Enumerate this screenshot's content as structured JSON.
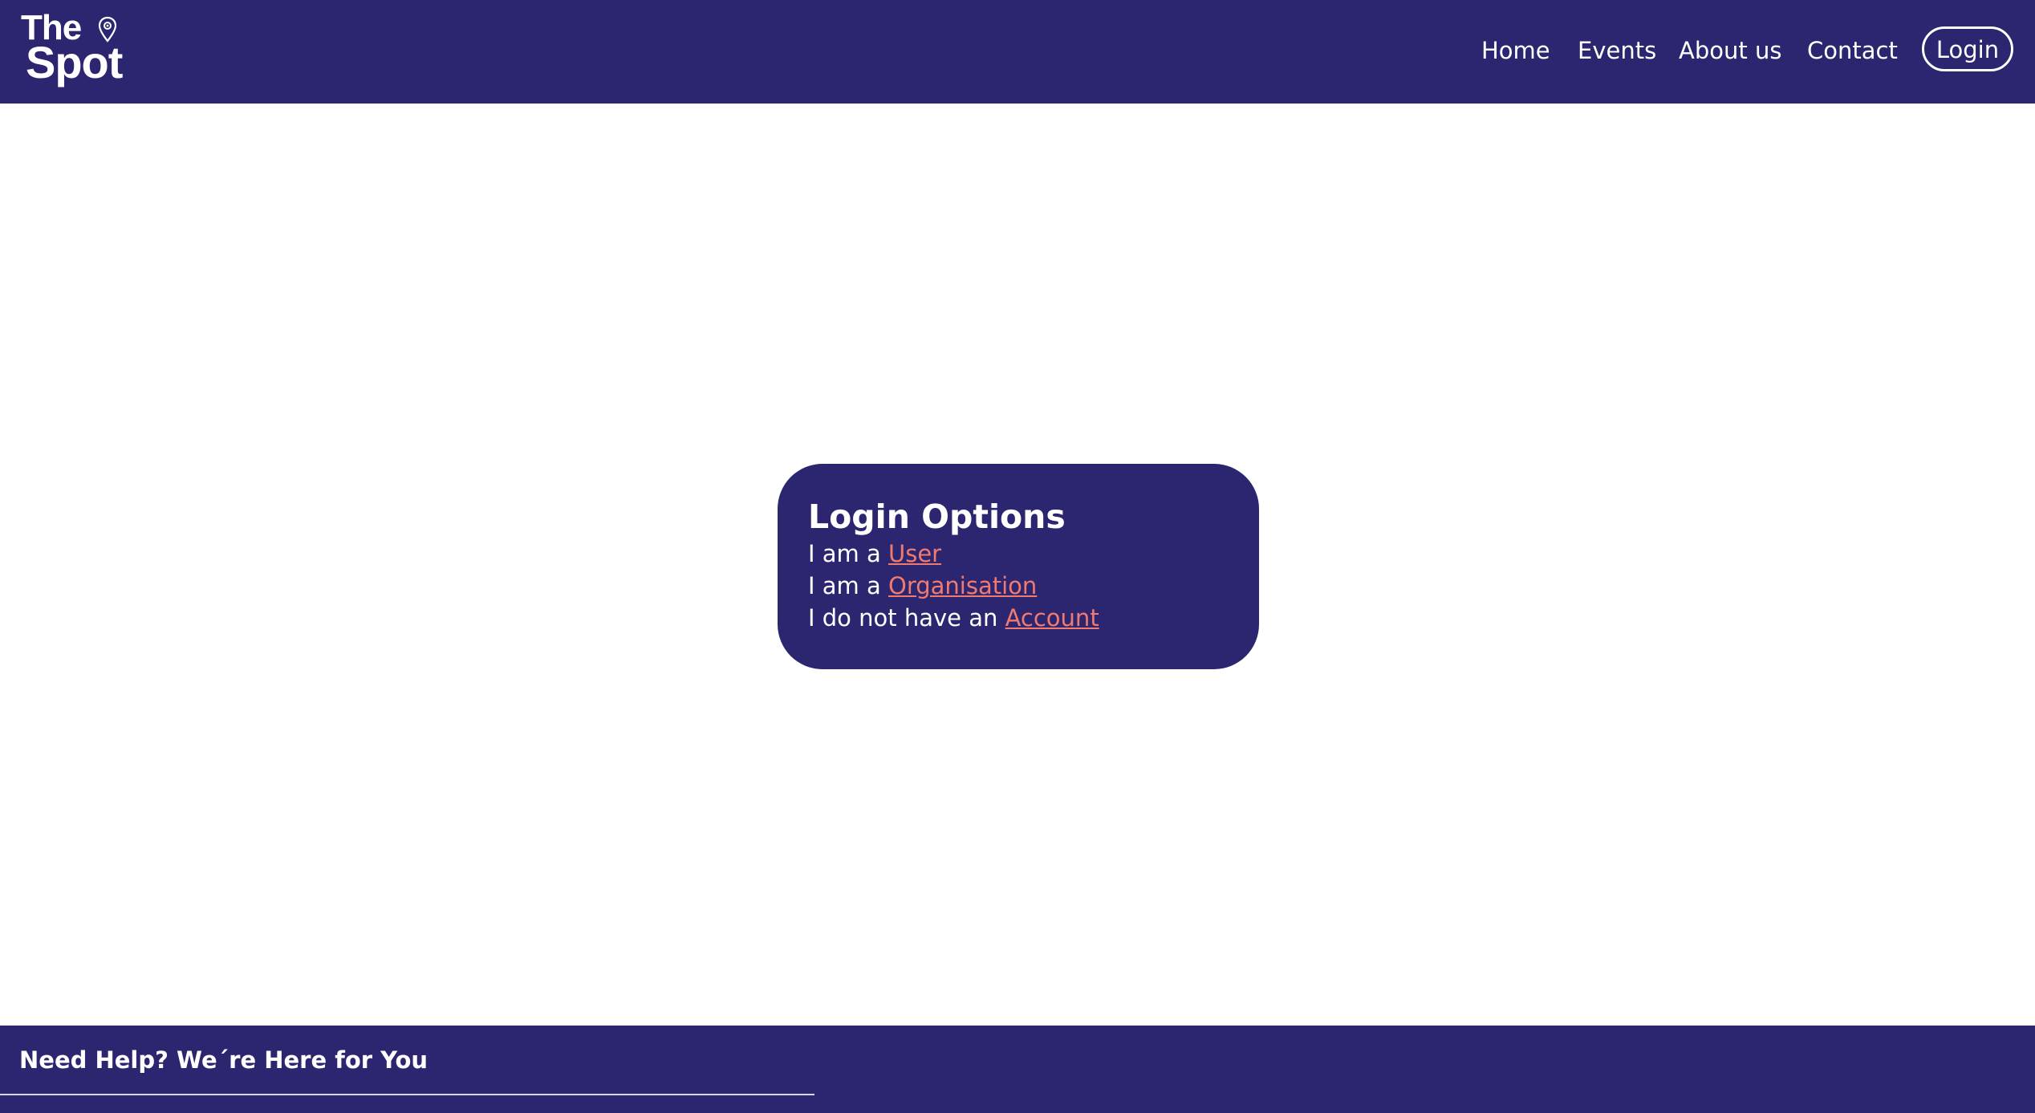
{
  "brand": {
    "line1": "The",
    "line2": "Spot",
    "pin_icon": "map-pin-icon"
  },
  "nav": {
    "items": [
      {
        "label": "Home"
      },
      {
        "label": "Events"
      },
      {
        "label": "About us"
      },
      {
        "label": "Contact"
      }
    ],
    "login_label": "Login"
  },
  "login_options": {
    "title": "Login Options",
    "lines": [
      {
        "prefix": "I am a ",
        "link": "User"
      },
      {
        "prefix": "I am a ",
        "link": "Organisation"
      },
      {
        "prefix": "I do not have an ",
        "link": "Account"
      }
    ]
  },
  "footer": {
    "title": "Need Help? We´re Here for You"
  },
  "colors": {
    "primary": "#2c2671",
    "accent_link": "#f07a6e",
    "text_on_primary": "#ffffff",
    "page_background": "#ffffff"
  }
}
